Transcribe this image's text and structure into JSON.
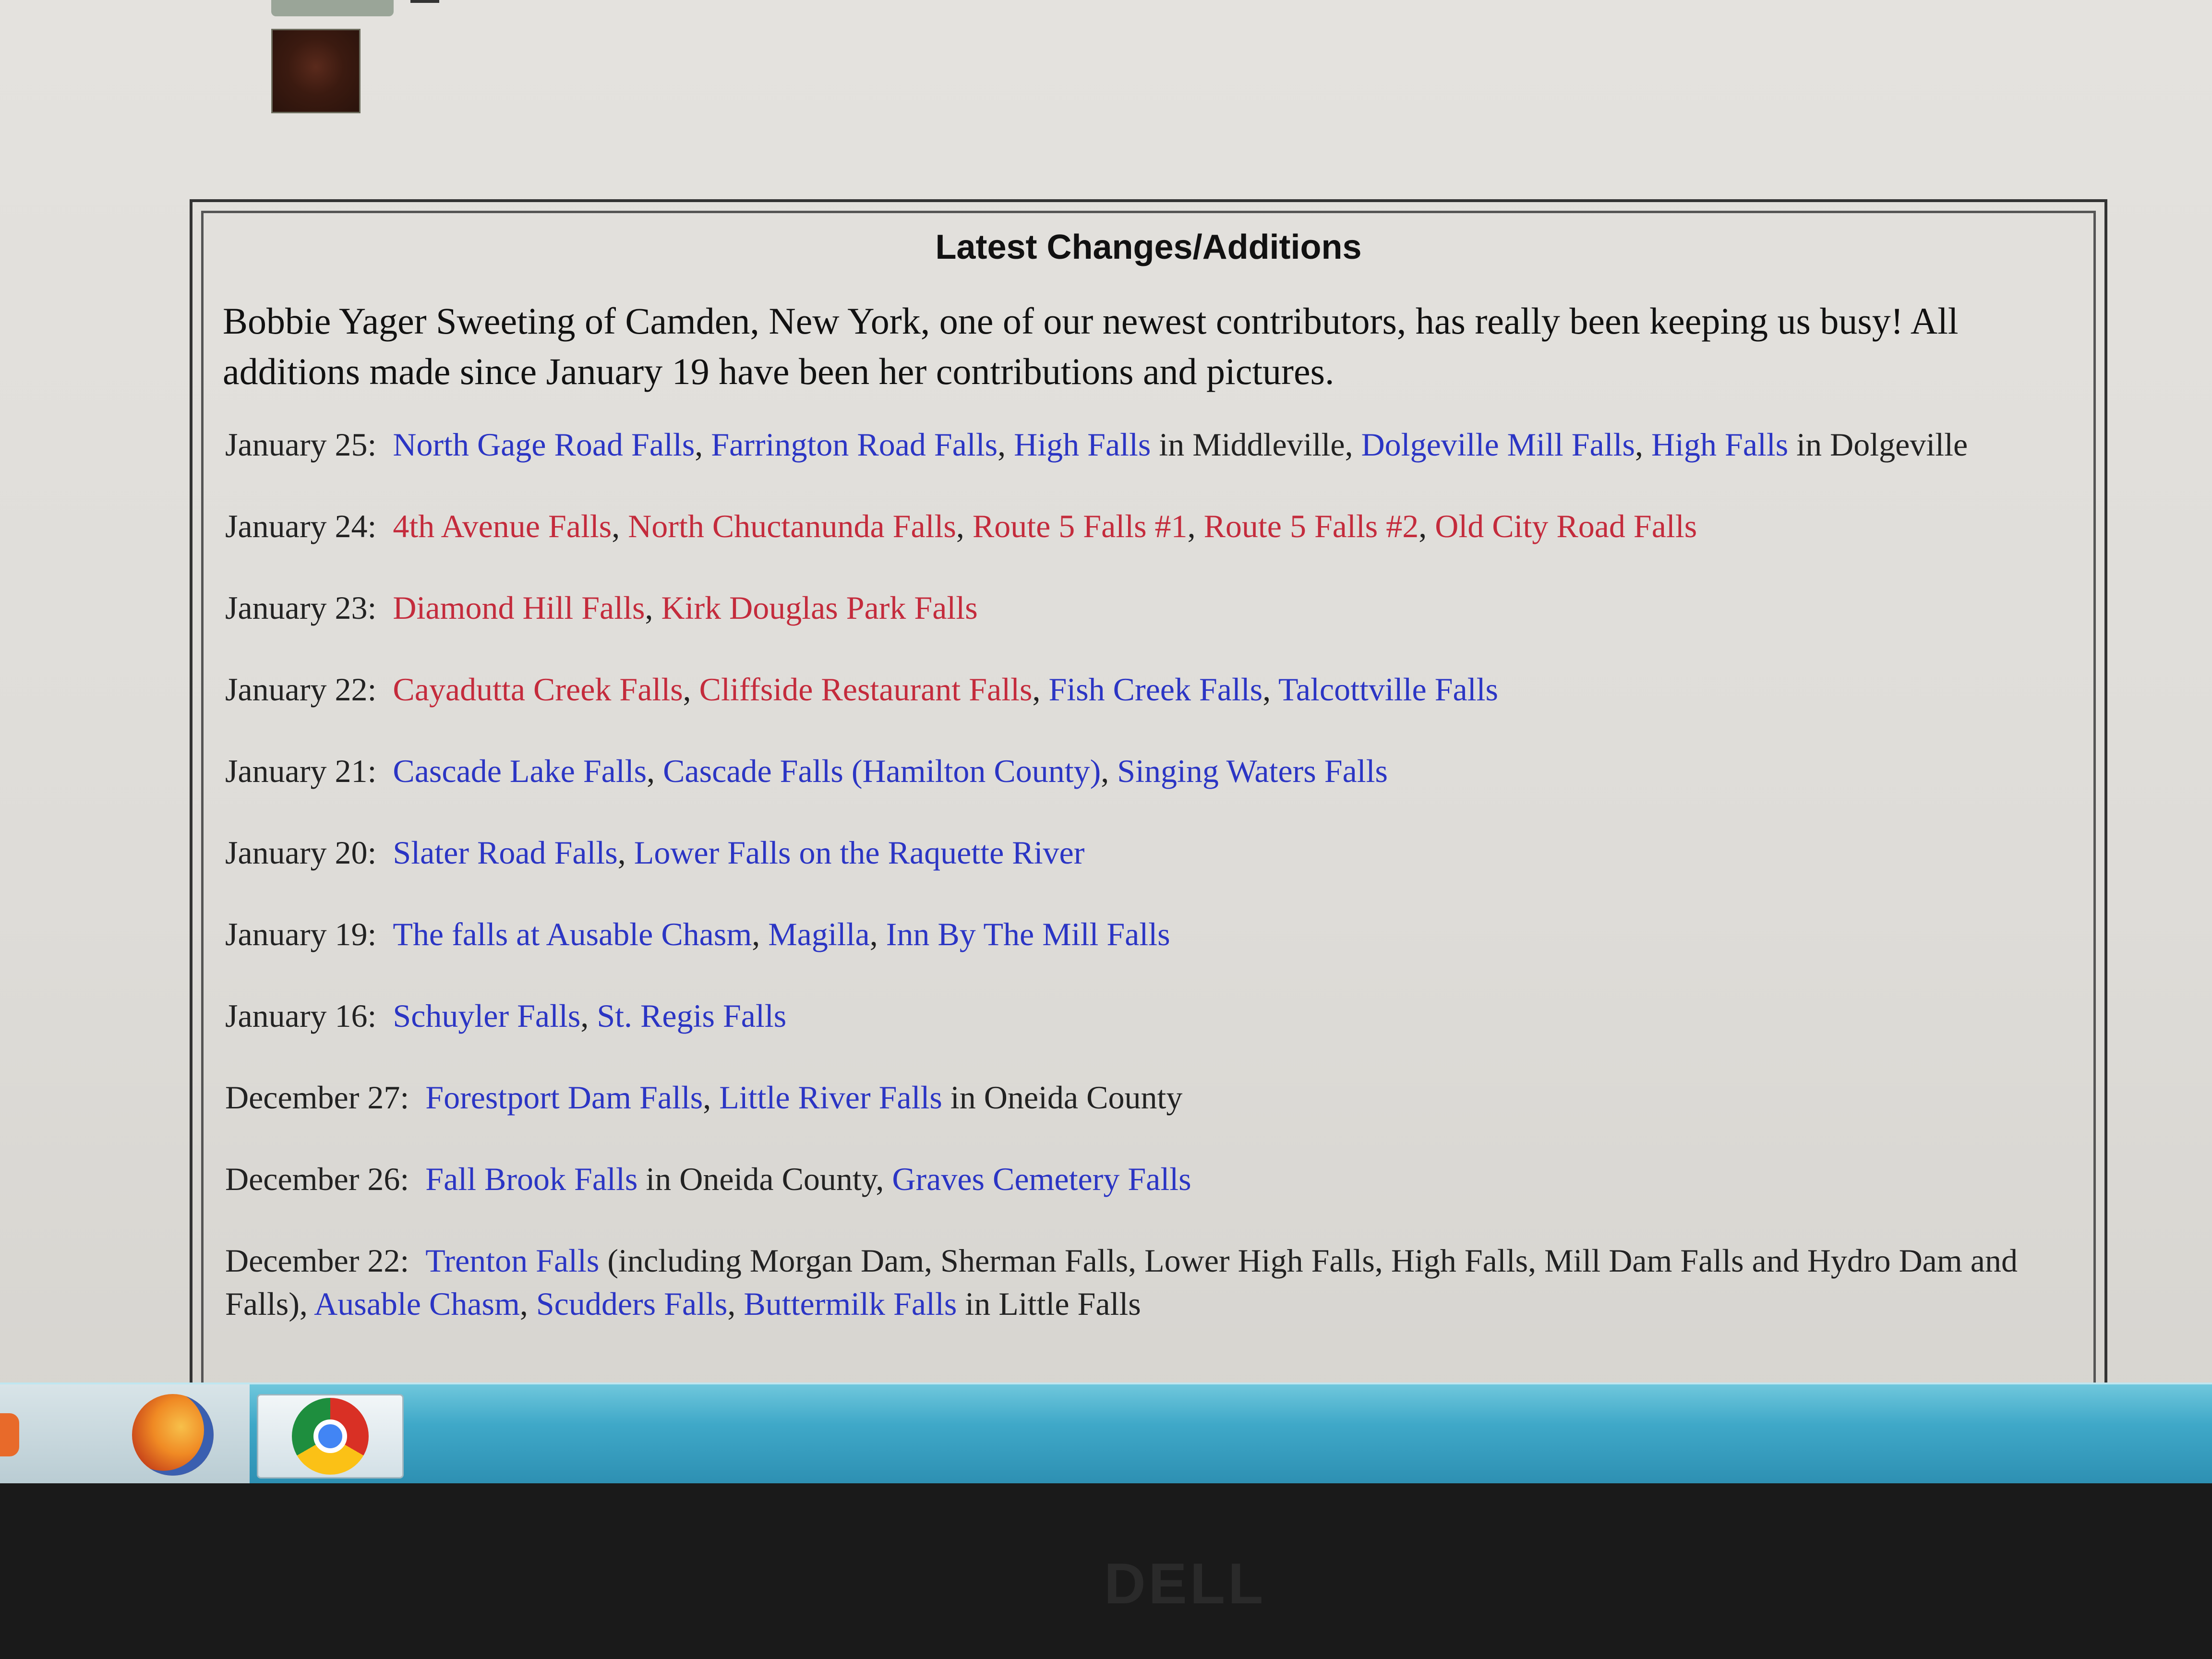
{
  "panel": {
    "title": "Latest Changes/Additions",
    "intro": "Bobbie Yager Sweeting of Camden, New York, one of our newest contributors, has really been keeping us busy!  All additions made since January 19 have been her contributions and pictures."
  },
  "entries": [
    {
      "date": "January 25:",
      "parts": [
        {
          "text": "North Gage Road Falls",
          "style": "blue"
        },
        {
          "text": ", ",
          "style": "plain"
        },
        {
          "text": "Farrington Road Falls",
          "style": "blue"
        },
        {
          "text": ", ",
          "style": "plain"
        },
        {
          "text": "High Falls",
          "style": "blue"
        },
        {
          "text": " in Middleville, ",
          "style": "plain"
        },
        {
          "text": "Dolgeville Mill Falls",
          "style": "blue"
        },
        {
          "text": ", ",
          "style": "plain"
        },
        {
          "text": "High Falls",
          "style": "blue"
        },
        {
          "text": " in Dolgeville",
          "style": "plain"
        }
      ]
    },
    {
      "date": "January 24:",
      "parts": [
        {
          "text": "4th Avenue Falls",
          "style": "red"
        },
        {
          "text": ", ",
          "style": "plain"
        },
        {
          "text": "North Chuctanunda Falls",
          "style": "red"
        },
        {
          "text": ", ",
          "style": "plain"
        },
        {
          "text": "Route 5 Falls #1",
          "style": "red"
        },
        {
          "text": ", ",
          "style": "plain"
        },
        {
          "text": "Route 5 Falls #2",
          "style": "red"
        },
        {
          "text": ", ",
          "style": "plain"
        },
        {
          "text": "Old City Road Falls",
          "style": "red"
        }
      ]
    },
    {
      "date": "January 23:",
      "parts": [
        {
          "text": "Diamond Hill Falls",
          "style": "red"
        },
        {
          "text": ", ",
          "style": "plain"
        },
        {
          "text": "Kirk Douglas Park Falls",
          "style": "red"
        }
      ]
    },
    {
      "date": "January 22:",
      "parts": [
        {
          "text": "Cayadutta Creek Falls",
          "style": "red"
        },
        {
          "text": ", ",
          "style": "plain"
        },
        {
          "text": "Cliffside Restaurant Falls",
          "style": "red"
        },
        {
          "text": ", ",
          "style": "plain"
        },
        {
          "text": "Fish Creek Falls",
          "style": "blue"
        },
        {
          "text": ", ",
          "style": "plain"
        },
        {
          "text": "Talcottville Falls",
          "style": "blue"
        }
      ]
    },
    {
      "date": "January 21:",
      "parts": [
        {
          "text": "Cascade Lake Falls",
          "style": "blue"
        },
        {
          "text": ", ",
          "style": "plain"
        },
        {
          "text": "Cascade Falls (Hamilton County)",
          "style": "blue"
        },
        {
          "text": ", ",
          "style": "plain"
        },
        {
          "text": "Singing Waters Falls",
          "style": "blue"
        }
      ]
    },
    {
      "date": "January 20:",
      "parts": [
        {
          "text": "Slater Road Falls",
          "style": "blue"
        },
        {
          "text": ",  ",
          "style": "plain"
        },
        {
          "text": "Lower Falls on the Raquette River",
          "style": "blue"
        }
      ]
    },
    {
      "date": "January 19:",
      "parts": [
        {
          "text": "The falls at Ausable Chasm",
          "style": "blue"
        },
        {
          "text": ", ",
          "style": "plain"
        },
        {
          "text": "Magilla",
          "style": "blue"
        },
        {
          "text": ", ",
          "style": "plain"
        },
        {
          "text": "Inn By The Mill Falls",
          "style": "blue"
        }
      ]
    },
    {
      "date": "January 16:",
      "parts": [
        {
          "text": "Schuyler Falls",
          "style": "blue"
        },
        {
          "text": ", ",
          "style": "plain"
        },
        {
          "text": "St. Regis Falls",
          "style": "blue"
        }
      ]
    },
    {
      "date": "December 27:",
      "parts": [
        {
          "text": "Forestport Dam Falls",
          "style": "blue"
        },
        {
          "text": ", ",
          "style": "plain"
        },
        {
          "text": "Little River Falls",
          "style": "blue"
        },
        {
          "text": " in Oneida County",
          "style": "plain"
        }
      ]
    },
    {
      "date": "December 26:",
      "parts": [
        {
          "text": "Fall Brook Falls",
          "style": "blue"
        },
        {
          "text": " in Oneida County, ",
          "style": "plain"
        },
        {
          "text": "Graves Cemetery Falls",
          "style": "blue"
        }
      ]
    },
    {
      "date": "December 22:",
      "parts": [
        {
          "text": "Trenton Falls",
          "style": "blue"
        },
        {
          "text": " (including Morgan Dam, Sherman Falls, Lower High Falls, High Falls, Mill Dam Falls and Hydro Dam and Falls), ",
          "style": "plain"
        },
        {
          "text": "Ausable Chasm",
          "style": "blue"
        },
        {
          "text": ", ",
          "style": "plain"
        },
        {
          "text": "Scudders Falls",
          "style": "blue"
        },
        {
          "text": ", ",
          "style": "plain"
        },
        {
          "text": "Buttermilk Falls",
          "style": "blue"
        },
        {
          "text": " in Little Falls",
          "style": "plain"
        }
      ]
    }
  ],
  "taskbar": {
    "items": [
      {
        "icon": "firefox-icon"
      },
      {
        "icon": "chrome-icon"
      }
    ]
  },
  "bezel": {
    "brand": "DELL"
  },
  "colors": {
    "link_blue": "#2b35c4",
    "link_red": "#c42b3c",
    "text": "#222222"
  }
}
